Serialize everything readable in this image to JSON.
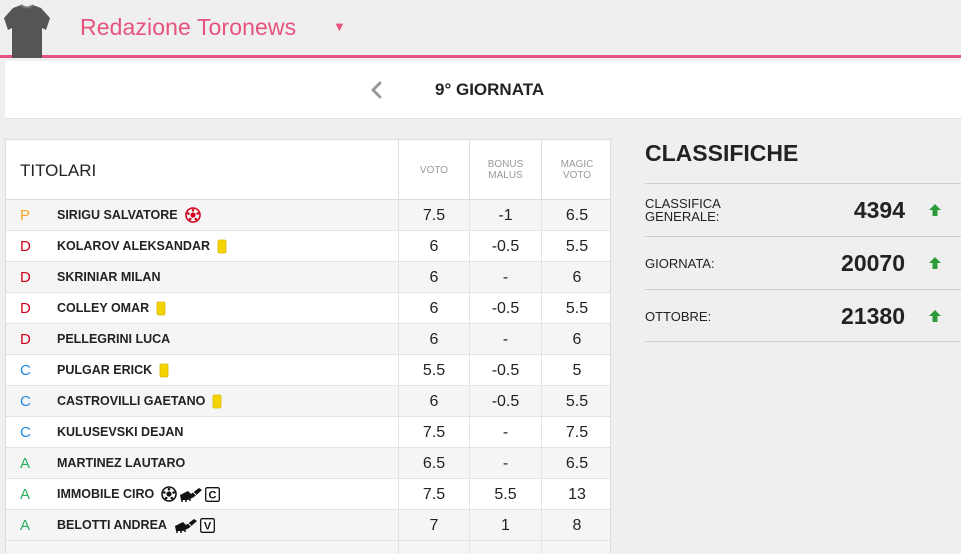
{
  "header": {
    "team_name": "Redazione Toronews",
    "dropdown_symbol": "▼",
    "accent_color": "#e6537e"
  },
  "round": {
    "prev_symbol": "‹",
    "label": "9° GIORNATA"
  },
  "table": {
    "title": "TITOLARI",
    "col_voto": "VOTO",
    "col_bonus": "BONUS\nMALUS",
    "col_magic": "MAGIC\nVOTO",
    "rows": [
      {
        "role": "P",
        "name": "SIRIGU SALVATORE",
        "events": [
          "goal-conceded-icon"
        ],
        "voto": "7.5",
        "bonus": "-1",
        "magic": "6.5"
      },
      {
        "role": "D",
        "name": "KOLAROV ALEKSANDAR",
        "events": [
          "yellow-card-icon"
        ],
        "voto": "6",
        "bonus": "-0.5",
        "magic": "5.5"
      },
      {
        "role": "D",
        "name": "SKRINIAR MILAN",
        "events": [],
        "voto": "6",
        "bonus": "-",
        "magic": "6"
      },
      {
        "role": "D",
        "name": "COLLEY OMAR",
        "events": [
          "yellow-card-icon"
        ],
        "voto": "6",
        "bonus": "-0.5",
        "magic": "5.5"
      },
      {
        "role": "D",
        "name": "PELLEGRINI LUCA",
        "events": [],
        "voto": "6",
        "bonus": "-",
        "magic": "6"
      },
      {
        "role": "C",
        "name": "PULGAR ERICK",
        "events": [
          "yellow-card-icon"
        ],
        "voto": "5.5",
        "bonus": "-0.5",
        "magic": "5"
      },
      {
        "role": "C",
        "name": "CASTROVILLI GAETANO",
        "events": [
          "yellow-card-icon"
        ],
        "voto": "6",
        "bonus": "-0.5",
        "magic": "5.5"
      },
      {
        "role": "C",
        "name": "KULUSEVSKI DEJAN",
        "events": [],
        "voto": "7.5",
        "bonus": "-",
        "magic": "7.5"
      },
      {
        "role": "A",
        "name": "MARTINEZ LAUTARO",
        "events": [],
        "voto": "6.5",
        "bonus": "-",
        "magic": "6.5"
      },
      {
        "role": "A",
        "name": "IMMOBILE CIRO",
        "events": [
          "goal-icon",
          "assist-boot-icon",
          "captain-c-icon"
        ],
        "voto": "7.5",
        "bonus": "5.5",
        "magic": "13"
      },
      {
        "role": "A",
        "name": "BELOTTI ANDREA",
        "events": [
          "assist-boot-icon",
          "vice-captain-v-icon"
        ],
        "voto": "7",
        "bonus": "1",
        "magic": "8"
      }
    ]
  },
  "classifiche": {
    "title": "CLASSIFICHE",
    "items": [
      {
        "label": "CLASSIFICA\nGENERALE:",
        "value": "4394",
        "trend": "up"
      },
      {
        "label": "GIORNATA:",
        "value": "20070",
        "trend": "up"
      },
      {
        "label": "OTTOBRE:",
        "value": "21380",
        "trend": "up"
      }
    ],
    "trend_color": "#2e9b3a"
  }
}
